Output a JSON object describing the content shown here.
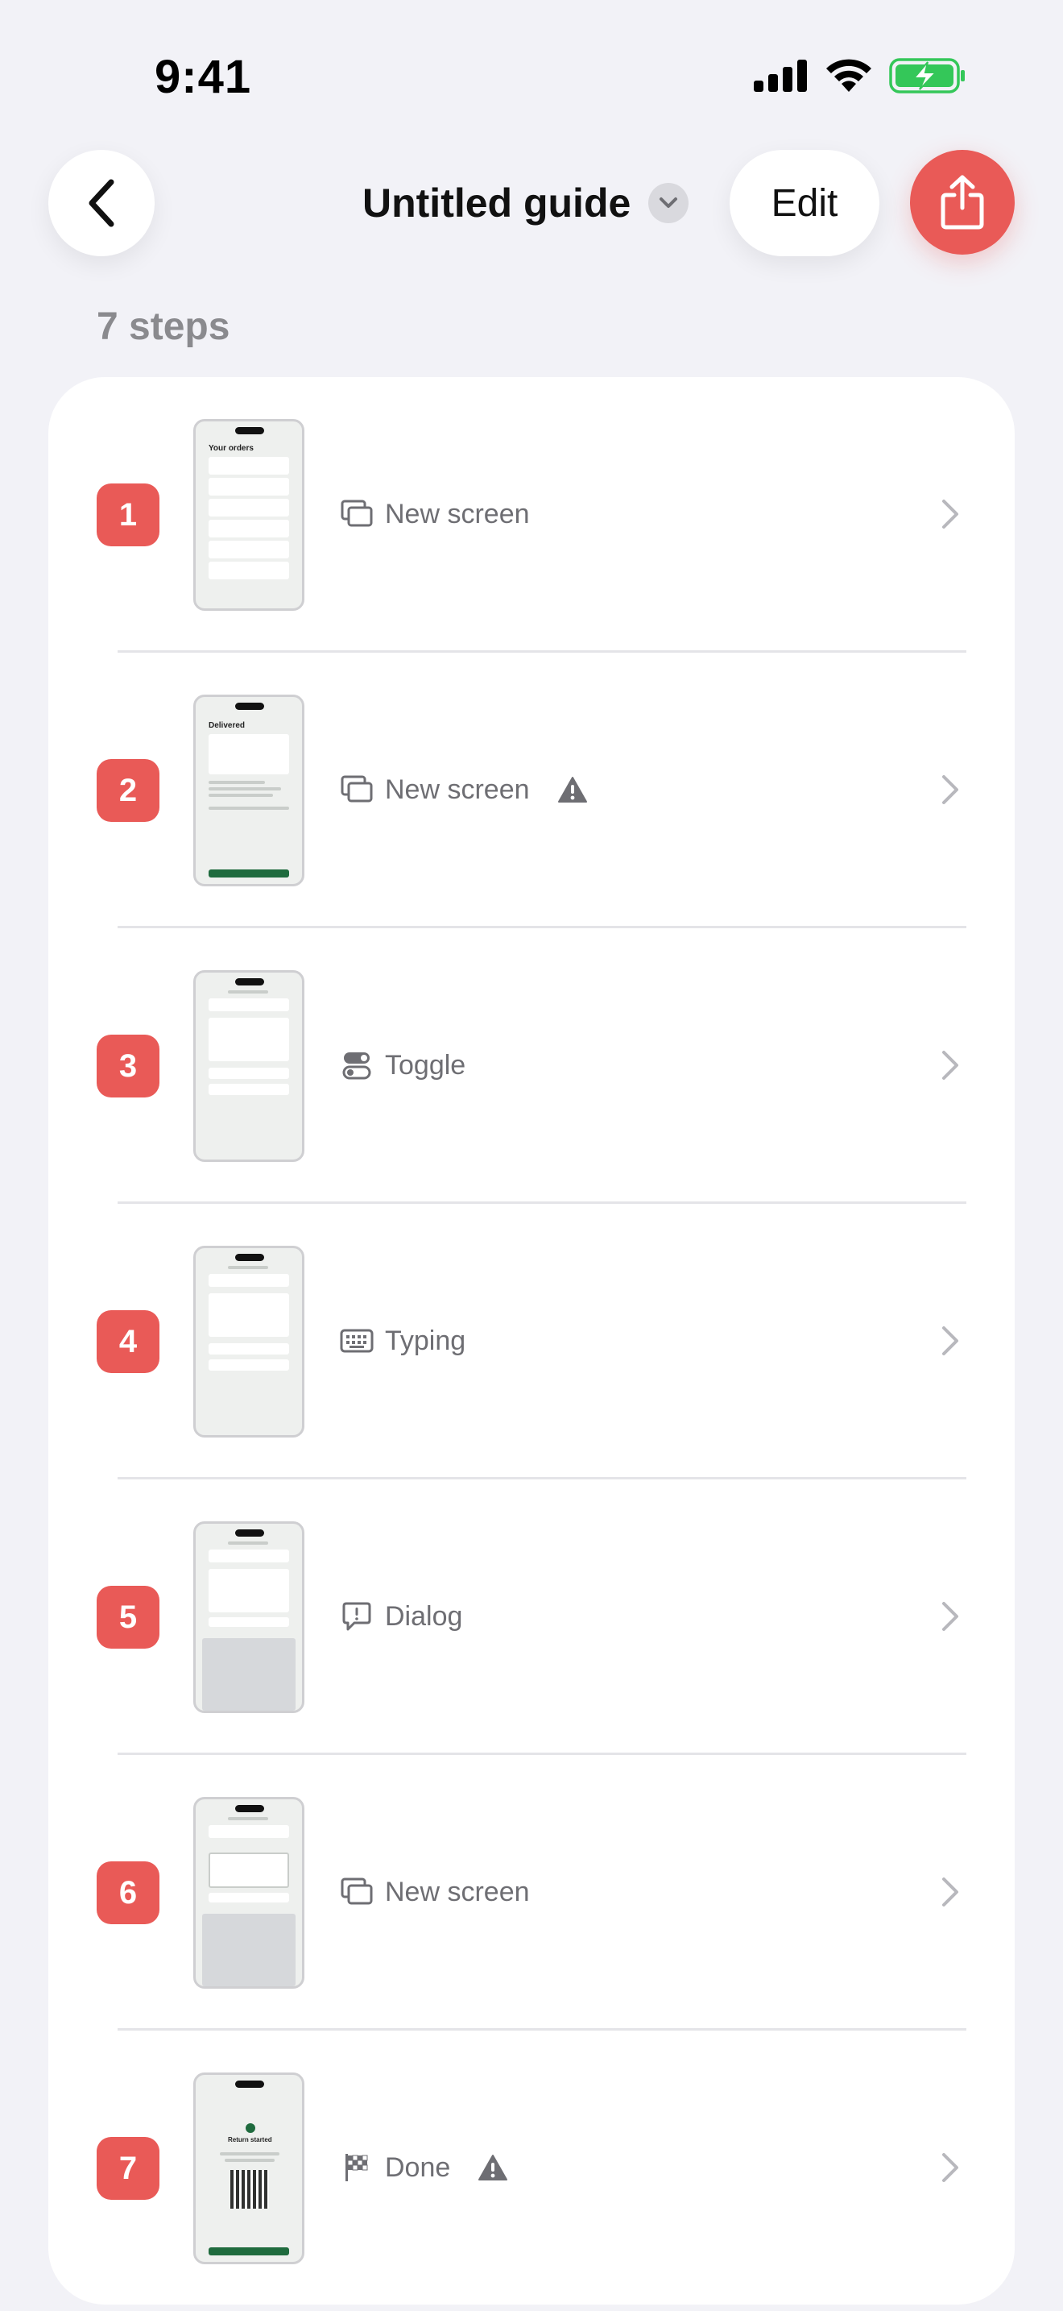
{
  "status_bar": {
    "time": "9:41"
  },
  "nav": {
    "title": "Untitled guide",
    "edit_label": "Edit"
  },
  "steps_count": "7 steps",
  "colors": {
    "accent": "#E95A57",
    "background": "#F2F2F7",
    "battery": "#34C759"
  },
  "steps": [
    {
      "number": "1",
      "type": "New screen",
      "icon": "new-screen-icon",
      "warning": false,
      "thumb": "Your orders"
    },
    {
      "number": "2",
      "type": "New screen",
      "icon": "new-screen-icon",
      "warning": true,
      "thumb": "Delivered"
    },
    {
      "number": "3",
      "type": "Toggle",
      "icon": "toggle-icon",
      "warning": false,
      "thumb": ""
    },
    {
      "number": "4",
      "type": "Typing",
      "icon": "keyboard-icon",
      "warning": false,
      "thumb": ""
    },
    {
      "number": "5",
      "type": "Dialog",
      "icon": "dialog-icon",
      "warning": false,
      "thumb": ""
    },
    {
      "number": "6",
      "type": "New screen",
      "icon": "new-screen-icon",
      "warning": false,
      "thumb": ""
    },
    {
      "number": "7",
      "type": "Done",
      "icon": "finish-flag-icon",
      "warning": true,
      "thumb": "Return started"
    }
  ]
}
